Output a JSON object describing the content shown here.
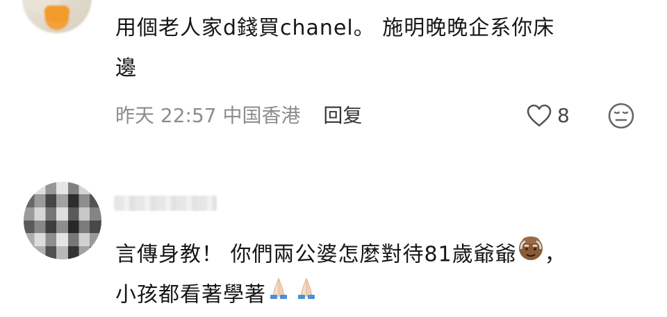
{
  "comment1": {
    "text_line1": "用個老人家d錢買chanel。 施明晚晚企系你床",
    "text_line2": "邊",
    "time": "昨天 22:57",
    "location": "中国香港",
    "reply_label": "回复",
    "like_count": "8",
    "icons": {
      "like": "heart-outline-icon",
      "react": "neutral-face-icon"
    }
  },
  "comment2": {
    "text_line1": "言傳身教！ 你們兩公婆怎麼對待81歲爺爺",
    "text_line1_suffix": "，",
    "text_line2": "小孩都看著學著",
    "icons": {
      "inline_emoji": "old-man-emoji-icon",
      "praying": "folded-hands-emoji-icon"
    }
  },
  "colors": {
    "text": "#161616",
    "meta": "#8c8c8c",
    "reply": "#333333"
  }
}
